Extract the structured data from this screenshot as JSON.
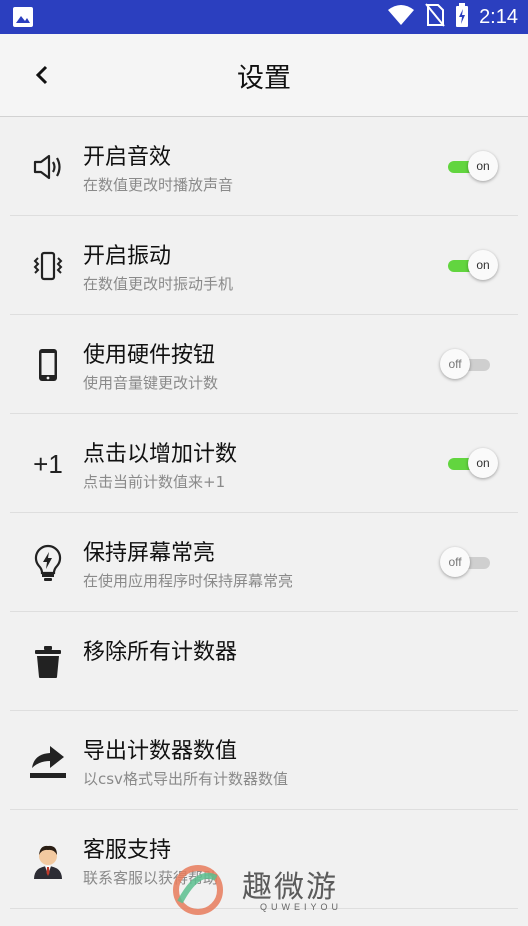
{
  "status_bar": {
    "time": "2:14",
    "icons": [
      "image-icon",
      "wifi-icon",
      "no-sim-icon",
      "battery-charging-icon"
    ]
  },
  "header": {
    "title": "设置",
    "back_icon": "chevron-left-icon"
  },
  "settings": [
    {
      "icon": "speaker-icon",
      "title": "开启音效",
      "subtitle": "在数值更改时播放声音",
      "toggle": "on"
    },
    {
      "icon": "vibrate-icon",
      "title": "开启振动",
      "subtitle": "在数值更改时振动手机",
      "toggle": "on"
    },
    {
      "icon": "phone-icon",
      "title": "使用硬件按钮",
      "subtitle": "使用音量键更改计数",
      "toggle": "off"
    },
    {
      "icon": "plus-one-icon",
      "icon_text": "+1",
      "title": "点击以增加计数",
      "subtitle": "点击当前计数值来+1",
      "toggle": "on"
    },
    {
      "icon": "lightbulb-icon",
      "title": "保持屏幕常亮",
      "subtitle": "在使用应用程序时保持屏幕常亮",
      "toggle": "off"
    },
    {
      "icon": "trash-icon",
      "title": "移除所有计数器"
    },
    {
      "icon": "share-export-icon",
      "title": "导出计数器数值",
      "subtitle": "以csv格式导出所有计数器数值"
    },
    {
      "icon": "support-agent-icon",
      "title": "客服支持",
      "subtitle": "联系客服以获得帮助"
    }
  ],
  "watermark": {
    "text": "趣微游",
    "subtext": "QUWEIYOU"
  },
  "colors": {
    "status_bar": "#2b3fbf",
    "toggle_on": "#62d53f",
    "toggle_off": "#cfcfcf"
  }
}
